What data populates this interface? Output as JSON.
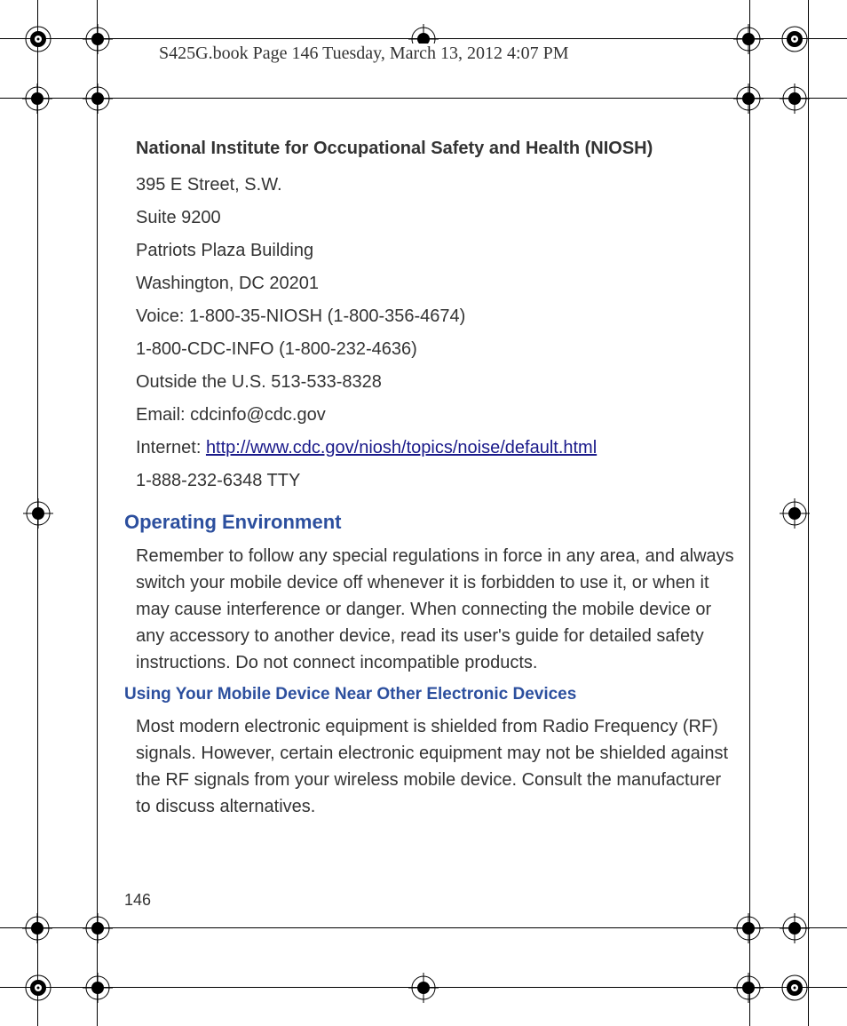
{
  "header": {
    "text": "S425G.book  Page 146  Tuesday, March 13, 2012  4:07 PM"
  },
  "org": {
    "title": "National Institute for Occupational Safety and Health (NIOSH)",
    "addr1": "395 E Street, S.W.",
    "addr2": "Suite 9200",
    "addr3": "Patriots Plaza Building",
    "addr4": "Washington, DC 20201",
    "voice": "Voice: 1-800-35-NIOSH (1-800-356-4674)",
    "cdcinfo": "1-800-CDC-INFO (1-800-232-4636)",
    "outside": "Outside the U.S. 513-533-8328",
    "email": "Email: cdcinfo@cdc.gov",
    "internet_label": "Internet: ",
    "internet_url": "http://www.cdc.gov/niosh/topics/noise/default.html",
    "tty": "1-888-232-6348 TTY"
  },
  "section1": {
    "heading": "Operating Environment",
    "body": "Remember to follow any special regulations in force in any area, and always switch your mobile device off whenever it is forbidden to use it, or when it may cause interference or danger. When connecting the mobile device or any accessory to another device, read its user's guide for detailed safety instructions. Do not connect incompatible products."
  },
  "section2": {
    "heading": "Using Your Mobile Device Near Other Electronic Devices",
    "body": "Most modern electronic equipment is shielded from Radio Frequency (RF) signals. However, certain electronic equipment may not be shielded against the RF signals from your wireless mobile device. Consult the manufacturer to discuss alternatives."
  },
  "page_number": "146"
}
